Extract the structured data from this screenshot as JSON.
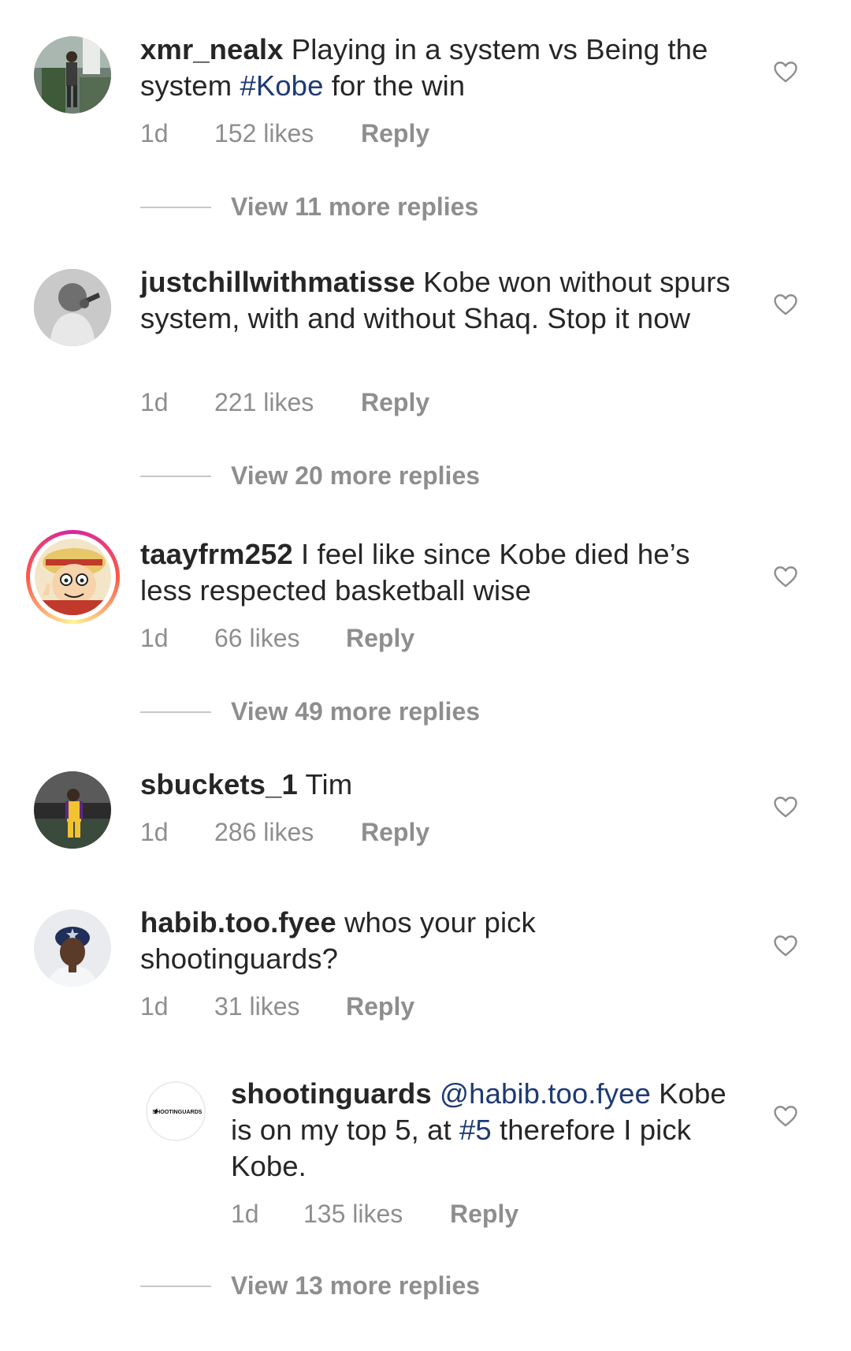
{
  "comments": [
    {
      "username": "xmr_nealx",
      "text_parts": [
        {
          "t": "Playing in a system vs Being the system "
        },
        {
          "t": "#Kobe",
          "link": true
        },
        {
          "t": " for the win"
        }
      ],
      "time": "1d",
      "likes": "152 likes",
      "reply": "Reply",
      "view_more": "View 11 more replies"
    },
    {
      "username": "justchillwithmatisse",
      "text_parts": [
        {
          "t": "Kobe won without spurs system, with and without Shaq. Stop it now"
        }
      ],
      "time": "1d",
      "likes": "221 likes",
      "reply": "Reply",
      "view_more": "View 20 more replies"
    },
    {
      "username": "taayfrm252",
      "text_parts": [
        {
          "t": "I feel like since Kobe died he’s less respected basketball wise"
        }
      ],
      "time": "1d",
      "likes": "66 likes",
      "reply": "Reply",
      "view_more": "View 49 more replies"
    },
    {
      "username": "sbuckets_1",
      "text_parts": [
        {
          "t": "Tim"
        }
      ],
      "time": "1d",
      "likes": "286 likes",
      "reply": "Reply"
    },
    {
      "username": "habib.too.fyee",
      "text_parts": [
        {
          "t": "whos your pick shootinguards?"
        }
      ],
      "time": "1d",
      "likes": "31 likes",
      "reply": "Reply"
    },
    {
      "username": "shootinguards",
      "avatar_text": "SHOOTINGUARDS",
      "text_parts": [
        {
          "t": "@habib.too.fyee",
          "link": true
        },
        {
          "t": " Kobe is on my top 5, at "
        },
        {
          "t": "#5",
          "link": true
        },
        {
          "t": " therefore I pick Kobe."
        }
      ],
      "time": "1d",
      "likes": "135 likes",
      "reply": "Reply",
      "view_more": "View 13 more replies"
    }
  ],
  "colors": {
    "text": "#262626",
    "link": "#1e3a73",
    "meta": "#8e8e8e",
    "divider": "#c7c7c7"
  },
  "icons": {
    "like": "heart-outline-icon"
  }
}
